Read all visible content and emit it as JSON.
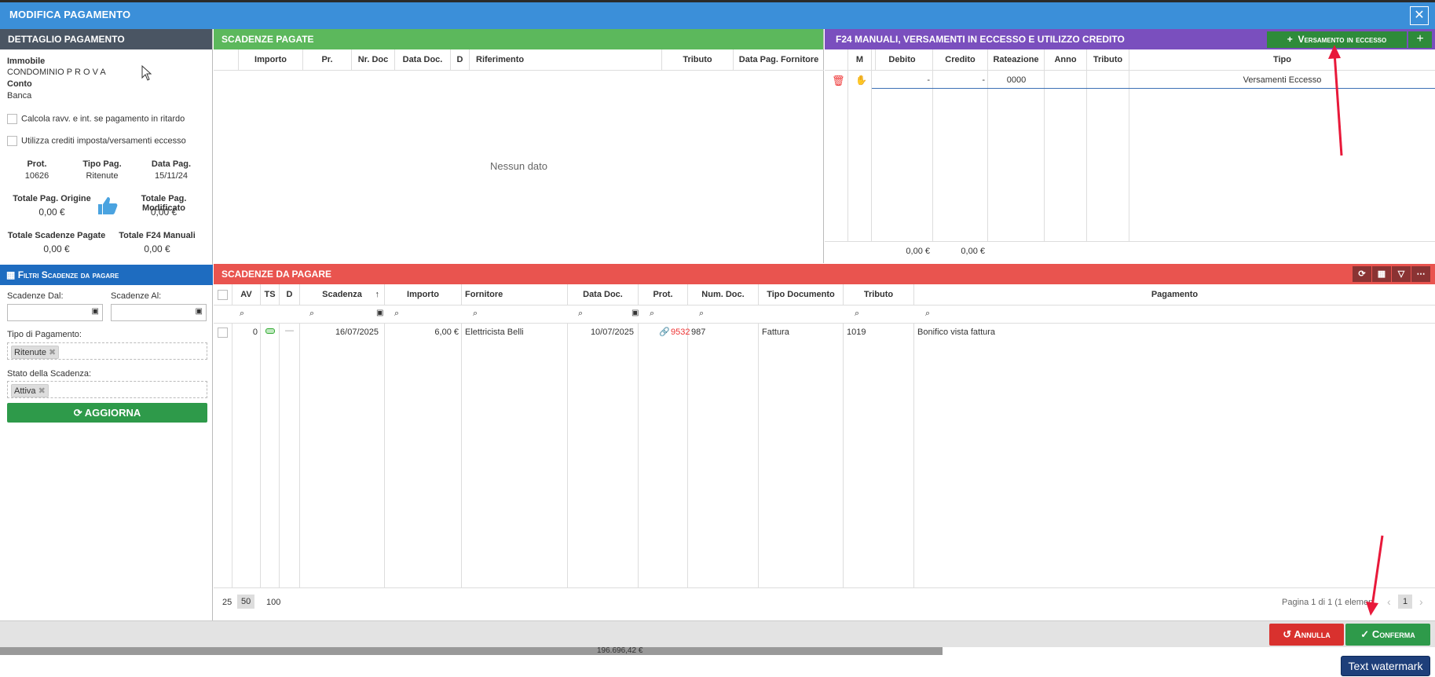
{
  "window": {
    "title": "MODIFICA PAGAMENTO"
  },
  "dettaglio": {
    "header": "DETTAGLIO PAGAMENTO",
    "immobile_label": "Immobile",
    "immobile_value": "CONDOMINIO P R O V A",
    "conto_label": "Conto",
    "conto_value": "Banca",
    "chk1": "Calcola ravv. e int. se pagamento in ritardo",
    "chk2": "Utilizza crediti imposta/versamenti eccesso",
    "prot_label": "Prot.",
    "prot_value": "10626",
    "tipo_label": "Tipo Pag.",
    "tipo_value": "Ritenute",
    "data_label": "Data Pag.",
    "data_value": "15/11/24",
    "tot_orig_label": "Totale Pag. Origine",
    "tot_orig_value": "0,00 €",
    "tot_mod_label": "Totale Pag. Modificato",
    "tot_mod_value": "0,00 €",
    "tot_scad_label": "Totale Scadenze Pagate",
    "tot_scad_value": "0,00 €",
    "tot_f24_label": "Totale F24 Manuali",
    "tot_f24_value": "0,00 €"
  },
  "filtri": {
    "header": "Filtri Scadenze da pagare",
    "dal_label": "Scadenze Dal:",
    "al_label": "Scadenze Al:",
    "tipo_label": "Tipo di Pagamento:",
    "tipo_tag": "Ritenute",
    "stato_label": "Stato della Scadenza:",
    "stato_tag": "Attiva",
    "aggiorna": "AGGIORNA"
  },
  "scadenze_pagate": {
    "header": "SCADENZE PAGATE",
    "columns": [
      "Importo",
      "Pr.",
      "Nr. Doc",
      "Data Doc.",
      "D",
      "Riferimento",
      "Tributo",
      "Data Pag. Fornitore"
    ],
    "empty": "Nessun dato"
  },
  "f24": {
    "header": "F24 MANUALI, VERSAMENTI IN ECCESSO E UTILIZZO CREDITO",
    "add_button": "Versamento in eccesso",
    "columns": [
      "M",
      "Debito",
      "Credito",
      "Rateazione",
      "Anno",
      "Tributo",
      "Tipo"
    ],
    "row": {
      "debito": "-",
      "credito": "-",
      "rateazione": "0000",
      "tipo": "Versamenti Eccesso"
    },
    "total_debito": "0,00 €",
    "total_credito": "0,00 €"
  },
  "scadenze_da_pagare": {
    "header": "SCADENZE DA PAGARE",
    "columns": [
      "AV",
      "TS",
      "D",
      "Scadenza",
      "Importo",
      "Fornitore",
      "Data Doc.",
      "Prot.",
      "Num. Doc.",
      "Tipo Documento",
      "Tributo",
      "Pagamento"
    ],
    "row": {
      "av": "0",
      "scadenza": "16/07/2025",
      "importo": "6,00 €",
      "fornitore": "Elettricista Belli",
      "data_doc": "10/07/2025",
      "prot": "9532",
      "num_doc": "987",
      "tipo_doc": "Fattura",
      "tributo": "1019",
      "pagamento": "Bonifico vista fattura"
    },
    "page_sizes": [
      "25",
      "50",
      "100"
    ],
    "pager_text": "Pagina 1 di 1 (1 elemen",
    "page": "1"
  },
  "footer": {
    "annulla": "Annulla",
    "conferma": "Conferma",
    "under_value": "196.696,42 €"
  },
  "watermark": "Text watermark",
  "colors": {
    "title": "#3b8fd9",
    "green": "#5cb85c",
    "purple": "#7a4fbe",
    "red": "#e9544f",
    "accent_arrow": "#e8193a"
  }
}
